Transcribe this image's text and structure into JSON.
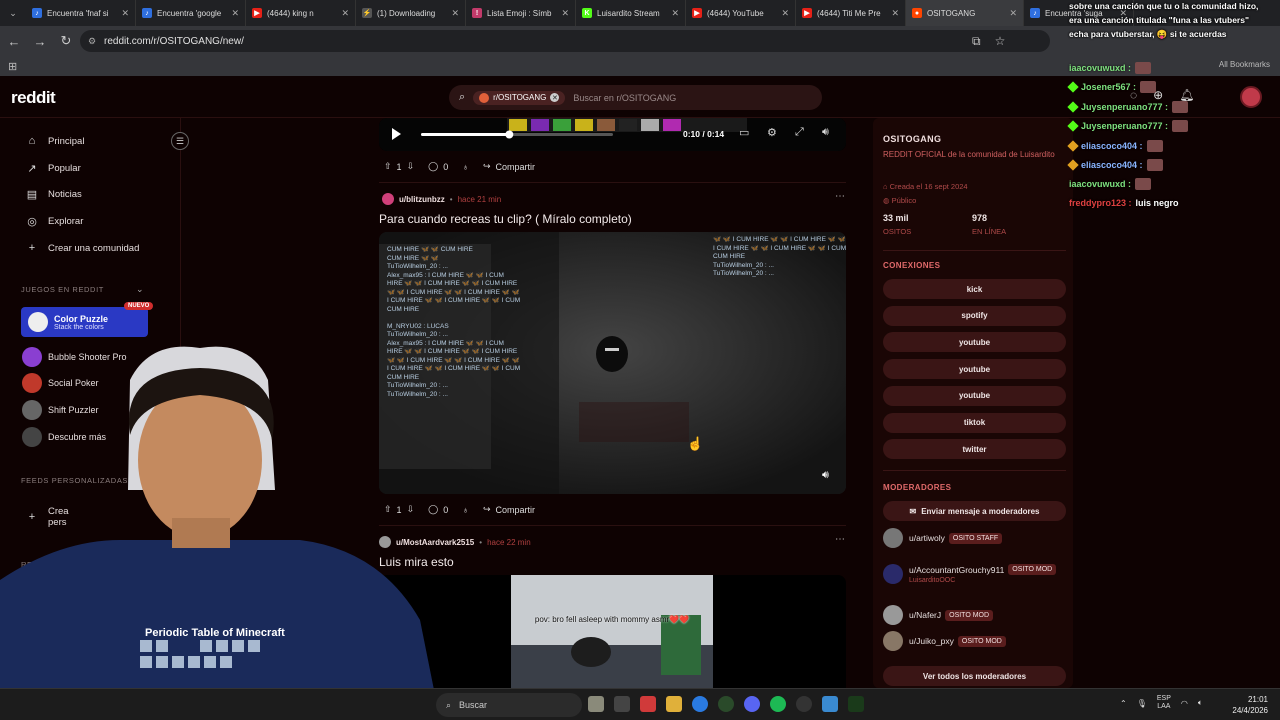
{
  "browser": {
    "tabs": [
      {
        "title": "Encuentra 'fnaf si",
        "color": "#2f6fdf",
        "glyph": "♪"
      },
      {
        "title": "Encuentra 'google",
        "color": "#2f6fdf",
        "glyph": "♪"
      },
      {
        "title": "(4644) king n",
        "color": "#e62117",
        "glyph": "▶"
      },
      {
        "title": "(1) Downloading",
        "color": "#555555",
        "glyph": "⚡"
      },
      {
        "title": "Lista Emoji : Símb",
        "color": "#c23a6a",
        "glyph": "!"
      },
      {
        "title": "Luisardito Stream",
        "color": "#53fc18",
        "glyph": "K"
      },
      {
        "title": "(4644) YouTube",
        "color": "#e62117",
        "glyph": "▶"
      },
      {
        "title": "(4644) Titi Me Pre",
        "color": "#e62117",
        "glyph": "▶"
      },
      {
        "title": "OSITOGANG",
        "color": "#ff4500",
        "glyph": "●",
        "active": true
      },
      {
        "title": "Encuentra 'suga",
        "color": "#2f6fdf",
        "glyph": "♪"
      }
    ],
    "url": "reddit.com/r/OSITOGANG/new/",
    "all_bookmarks": "All Bookmarks"
  },
  "header": {
    "logo": "reddit",
    "search_chip": "r/OSITOGANG",
    "search_placeholder": "Buscar en r/OSITOGANG"
  },
  "sidebar": {
    "nav": [
      {
        "label": "Principal",
        "icon": "home-icon",
        "glyph": "⌂"
      },
      {
        "label": "Popular",
        "icon": "popular-icon",
        "glyph": "↗"
      },
      {
        "label": "Noticias",
        "icon": "news-icon",
        "glyph": "▤"
      },
      {
        "label": "Explorar",
        "icon": "explore-icon",
        "glyph": "◎"
      },
      {
        "label": "Crear una comunidad",
        "icon": "plus-icon",
        "glyph": "+"
      }
    ],
    "games_title": "JUEGOS EN REDDIT",
    "color_puzzle": {
      "title": "Color Puzzle",
      "subtitle": "Stack the colors",
      "badge": "NUEVO"
    },
    "games": [
      {
        "label": "Bubble Shooter Pro",
        "color": "#8a3fd1"
      },
      {
        "label": "Social Poker",
        "color": "#c0392b"
      },
      {
        "label": "Shift Puzzler",
        "color": "#666666"
      },
      {
        "label": "Descubre más",
        "color": "#444444"
      }
    ],
    "feeds_title": "FEEDS PERSONALIZADAS",
    "create_feed": "Crea",
    "create_feed_2": "pers",
    "recent_title": "RECIENTE"
  },
  "video1": {
    "time": "0:10 / 0:14",
    "progress": 0.46
  },
  "post1_actions": {
    "votes": "1",
    "comments": "0",
    "share": "Compartir"
  },
  "post2": {
    "user": "u/blitzunbzz",
    "time": "hace 21 min",
    "title": "Para cuando recreas tu clip? ( Míralo completo)",
    "votes": "1",
    "comments": "0",
    "share": "Compartir"
  },
  "post3": {
    "user": "u/MostAardvark2515",
    "time": "hace 22 min",
    "title": "Luis mira esto",
    "caption": "pov: bro fell asleep with mommy asmr❤️❤️"
  },
  "community": {
    "name": "OSITOGANG",
    "description": "REDDIT OFICIAL de la comunidad de Luisardito",
    "created": "Creada el 16 sept 2024",
    "visibility": "Público",
    "members_value": "33 mil",
    "members_label": "OSITOS",
    "online_value": "978",
    "online_label": "EN LÍNEA",
    "connections_title": "CONEXIONES",
    "connections": [
      "kick",
      "spotify",
      "youtube",
      "youtube",
      "youtube",
      "tiktok",
      "twitter"
    ],
    "moderators_title": "MODERADORES",
    "message_mods": "Enviar mensaje a moderadores",
    "moderators": [
      {
        "name": "u/artiwoly",
        "flair": "OSITO STAFF",
        "sub": "",
        "color": "#777777"
      },
      {
        "name": "u/AccountantGrouchy911",
        "flair": "OSITO MOD",
        "sub": "LuisarditoOOC",
        "color": "#2a2a6a"
      },
      {
        "name": "u/NaferJ",
        "flair": "OSITO MOD",
        "sub": "",
        "color": "#999999"
      },
      {
        "name": "u/Juiko_pxy",
        "flair": "OSITO MOD",
        "sub": "",
        "color": "#887766"
      }
    ],
    "all_mods": "Ver todos los moderadores"
  },
  "stream_chat": {
    "banner": [
      "sobre una canción que tu o la comunidad hizo,",
      "era una canción titulada \"funa a las vtubers\"",
      "echa para vtuberstar, 😝 si te acuerdas"
    ],
    "lines": [
      {
        "user": "iaacovuwuxd :",
        "color": "#7ee07e",
        "badge": ""
      },
      {
        "user": "Josener567 :",
        "color": "#7ee07e",
        "badge": "#53fc18"
      },
      {
        "user": "Juysenperuano777 :",
        "color": "#7ee07e",
        "badge": "#53fc18"
      },
      {
        "user": "Juysenperuano777 :",
        "color": "#7ee07e",
        "badge": "#53fc18"
      },
      {
        "user": "eliascoco404 :",
        "color": "#8ab4ff",
        "badge": "#e0a020"
      },
      {
        "user": "eliascoco404 :",
        "color": "#8ab4ff",
        "badge": "#e0a020"
      },
      {
        "user": "iaacovuwuxd :",
        "color": "#7ee07e",
        "badge": ""
      },
      {
        "user": "freddypro123 :",
        "color": "#e04040",
        "badge": "",
        "text": "luis negro"
      }
    ]
  },
  "taskbar": {
    "search": "Buscar",
    "lang_1": "ESP",
    "lang_2": "LAA",
    "time": "21:01",
    "date": "24/4/2026"
  }
}
